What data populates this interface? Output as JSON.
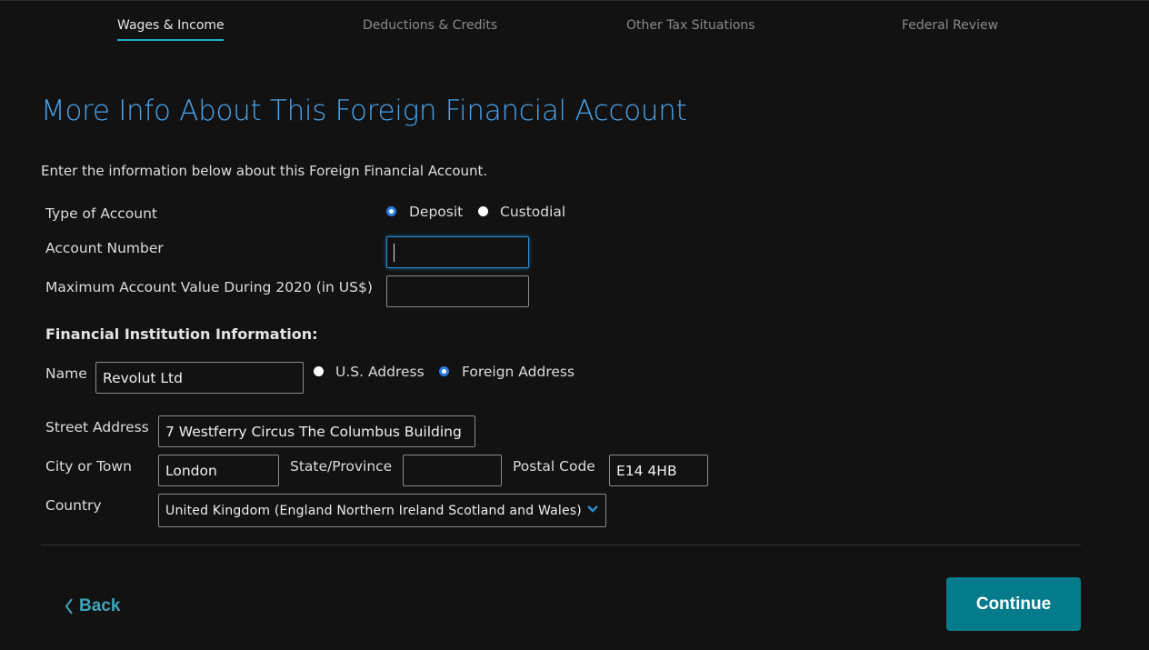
{
  "nav": {
    "tabs": [
      {
        "label": "Wages & Income",
        "active": true
      },
      {
        "label": "Deductions & Credits",
        "active": false
      },
      {
        "label": "Other Tax Situations",
        "active": false
      },
      {
        "label": "Federal Review",
        "active": false
      }
    ]
  },
  "page": {
    "title": "More Info About This Foreign Financial Account",
    "intro": "Enter the information below about this Foreign Financial Account."
  },
  "account": {
    "type_label": "Type of Account",
    "type_options": [
      {
        "label": "Deposit",
        "checked": true
      },
      {
        "label": "Custodial",
        "checked": false
      }
    ],
    "number_label": "Account Number",
    "number_value": "",
    "max_value_label": "Maximum Account Value During 2020 (in US$)",
    "max_value_value": ""
  },
  "institution": {
    "section_title": "Financial Institution Information:",
    "name_label": "Name",
    "name_value": "Revolut Ltd",
    "address_type_options": [
      {
        "label": "U.S. Address",
        "checked": false
      },
      {
        "label": "Foreign Address",
        "checked": true
      }
    ],
    "street_label": "Street Address",
    "street_value": "7 Westferry Circus The Columbus Building",
    "city_label": "City or Town",
    "city_value": "London",
    "state_label": "State/Province",
    "state_value": "",
    "postal_label": "Postal Code",
    "postal_value": "E14 4HB",
    "country_label": "Country",
    "country_value": "United Kingdom (England Northern Ireland Scotland and Wales)"
  },
  "footer": {
    "back_label": "Back",
    "continue_label": "Continue"
  },
  "colors": {
    "accent": "#1fb3c4",
    "title": "#4aa3ea",
    "primary_button": "#047b8b",
    "back_link": "#3ea5bb"
  }
}
